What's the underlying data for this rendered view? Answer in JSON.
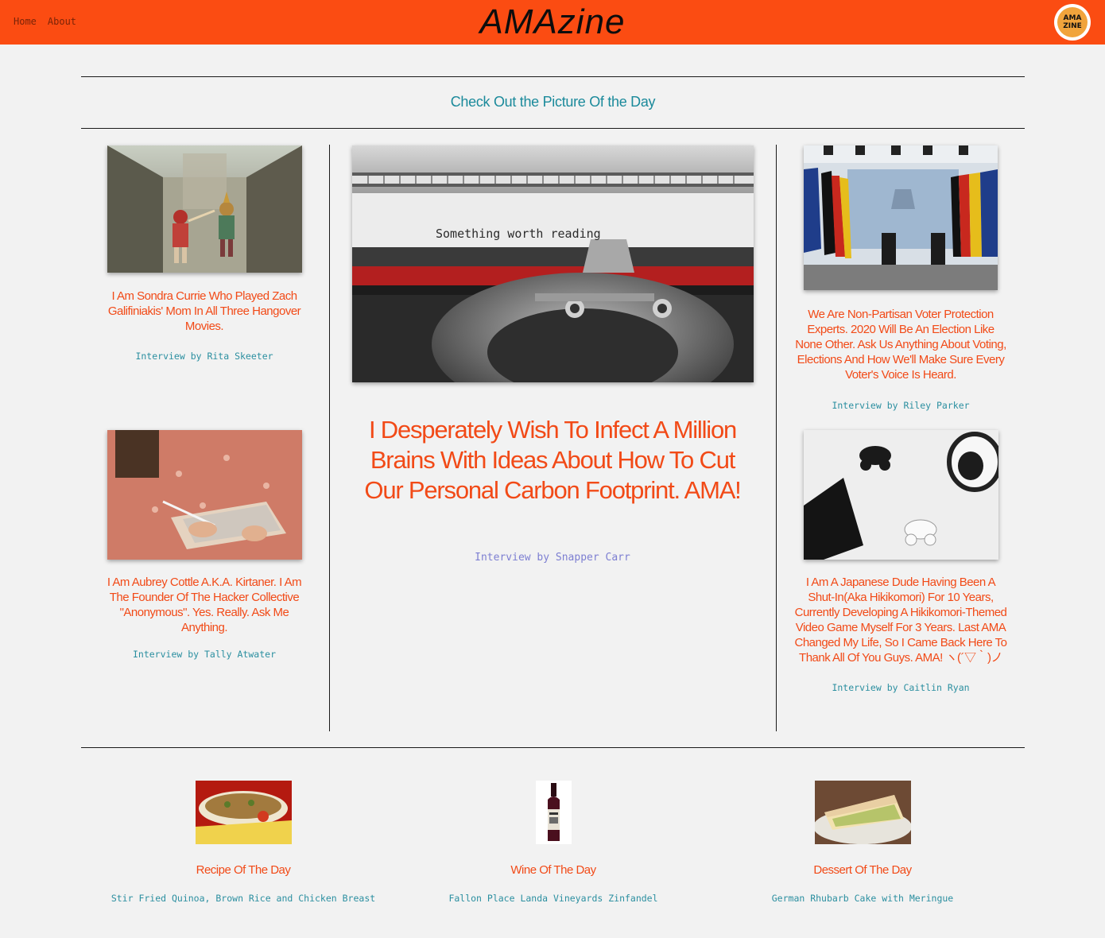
{
  "header": {
    "nav": [
      "Home",
      "About"
    ],
    "brand": "AMAzine",
    "logo_text": [
      "AMA",
      "ZINE"
    ]
  },
  "picture_of_day": "Check Out the Picture Of the Day",
  "feature": {
    "typewriter_text": "Something worth reading",
    "title": "I Desperately Wish To Infect A Million Brains With Ideas About How To Cut Our Personal Carbon Footprint. AMA!",
    "by": "Interview by Snapper Carr"
  },
  "left_cards": [
    {
      "title": "I Am Sondra Currie Who Played Zach Galifiniakis' Mom In All Three Hangover Movies.",
      "by": "Interview by Rita Skeeter"
    },
    {
      "title": "I Am Aubrey Cottle A.K.A. Kirtaner. I Am The Founder Of The Hacker Collective \"Anonymous\". Yes. Really. Ask Me Anything.",
      "by": "Interview by Tally Atwater"
    }
  ],
  "right_cards": [
    {
      "title": "We Are Non-Partisan Voter Protection Experts. 2020 Will Be An Election Like None Other. Ask Us Anything About Voting, Elections And How We'll Make Sure Every Voter's Voice Is Heard.",
      "by": "Interview by Riley Parker"
    },
    {
      "title": "I Am A Japanese Dude Having Been A Shut-In(Aka Hikikomori) For 10 Years, Currently Developing A Hikikomori-Themed Video Game Myself For 3 Years. Last AMA Changed My Life, So I Came Back Here To Thank All Of You Guys. AMA! ヽ(´▽｀)ノ",
      "by": "Interview by Caitlin Ryan"
    }
  ],
  "bottom": [
    {
      "title": "Recipe Of The Day",
      "sub": "Stir Fried Quinoa, Brown Rice and Chicken Breast"
    },
    {
      "title": "Wine Of The Day",
      "sub": "Fallon Place Landa Vineyards Zinfandel"
    },
    {
      "title": "Dessert Of The Day",
      "sub": "German Rhubarb Cake with Meringue"
    }
  ],
  "colors": {
    "header_bg": "#fb4c12",
    "accent_title": "#f24a17",
    "teal": "#2b8fa0",
    "feature_by": "#7d7fd2",
    "page_bg": "#f2f2f2"
  }
}
